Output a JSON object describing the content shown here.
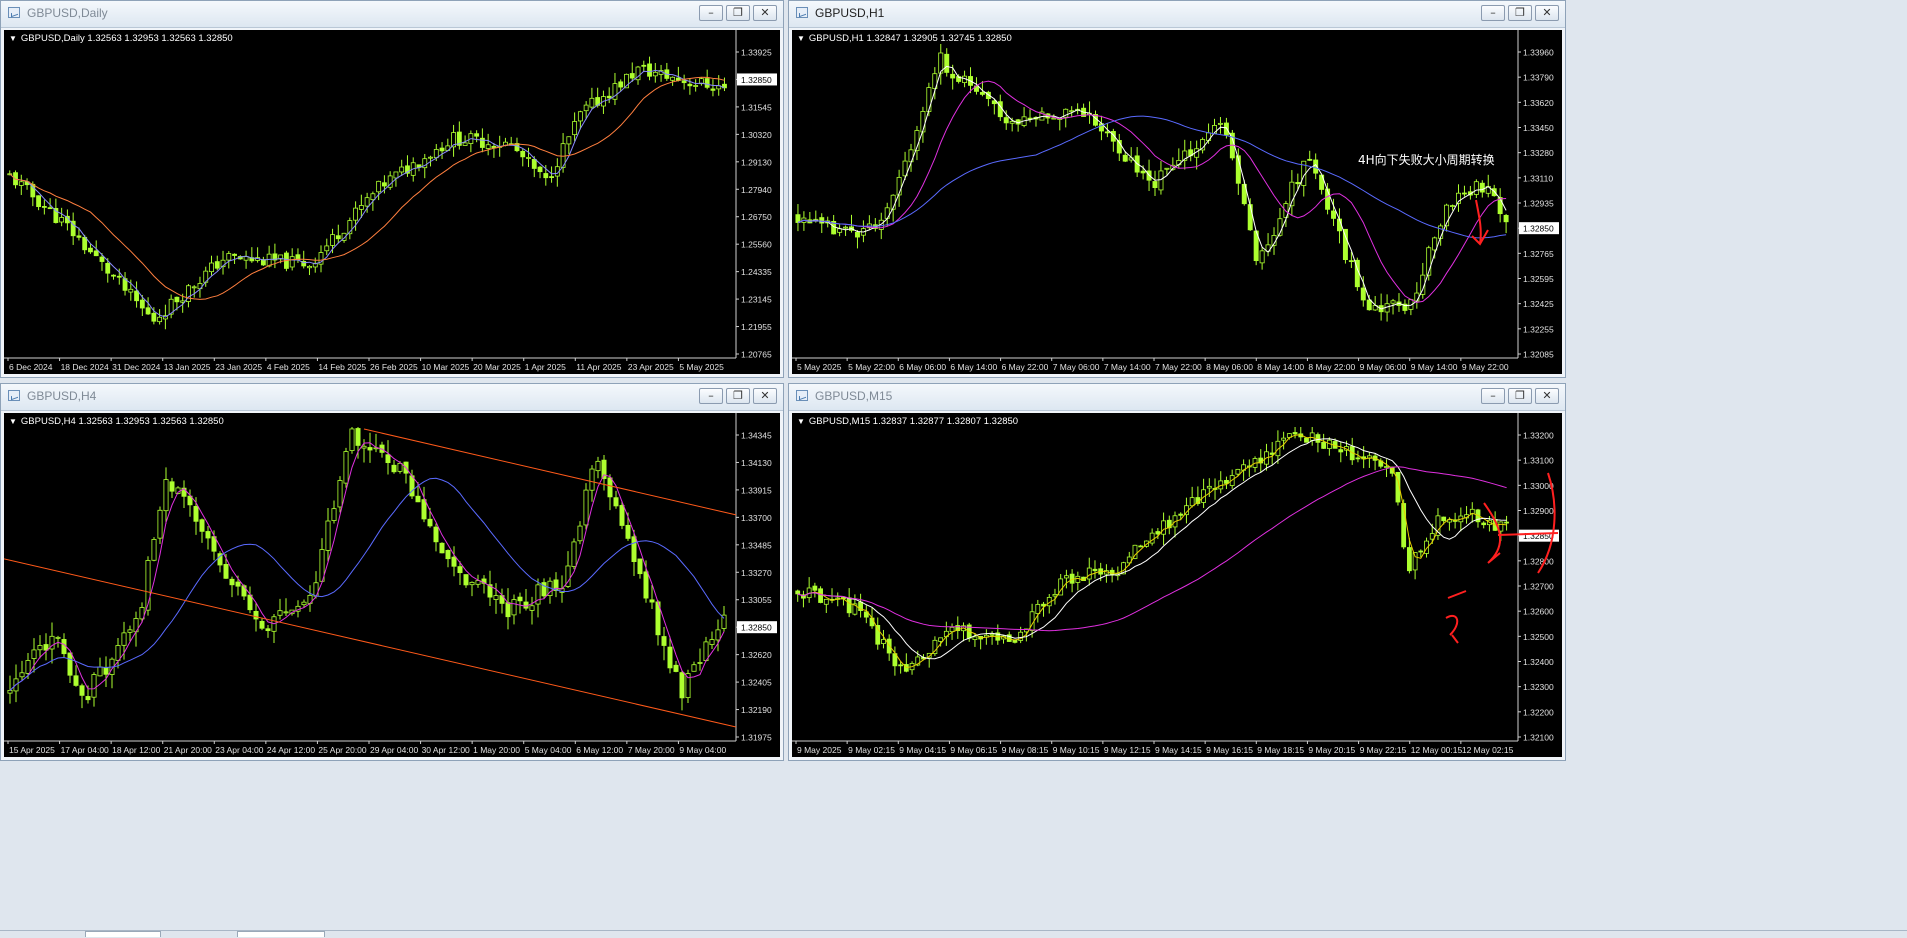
{
  "windows": [
    {
      "id": "daily",
      "title": "GBPUSD,Daily",
      "title_dim": true,
      "header": "GBPUSD,Daily  1.32563 1.32953 1.32563 1.32850",
      "price_levels": [
        "1.33925",
        "1.32850",
        "1.31545",
        "1.30320",
        "1.29130",
        "1.27940",
        "1.26750",
        "1.25560",
        "1.24335",
        "1.23145",
        "1.21955",
        "1.20765"
      ],
      "price_min": 1.2045,
      "price_max": 1.345,
      "current_price": "1.32850",
      "time_labels": [
        "6 Dec 2024",
        "18 Dec 2024",
        "31 Dec 2024",
        "13 Jan 2025",
        "23 Jan 2025",
        "4 Feb 2025",
        "14 Feb 2025",
        "26 Feb 2025",
        "10 Mar 2025",
        "20 Mar 2025",
        "1 Apr 2025",
        "11 Apr 2025",
        "23 Apr 2025",
        "5 May 2025"
      ],
      "annotation": ""
    },
    {
      "id": "h1",
      "title": "GBPUSD,H1",
      "title_dim": false,
      "header": "GBPUSD,H1  1.32847 1.32905 1.32745 1.32850",
      "price_levels": [
        "1.33960",
        "1.33790",
        "1.33620",
        "1.33450",
        "1.33280",
        "1.33110",
        "1.32935",
        "1.32850",
        "1.32765",
        "1.32595",
        "1.32425",
        "1.32255",
        "1.32085"
      ],
      "price_min": 1.3203,
      "price_max": 1.3409,
      "current_price": "1.32850",
      "time_labels": [
        "5 May 2025",
        "5 May 22:00",
        "6 May 06:00",
        "6 May 14:00",
        "6 May 22:00",
        "7 May 06:00",
        "7 May 14:00",
        "7 May 22:00",
        "8 May 06:00",
        "8 May 14:00",
        "8 May 22:00",
        "9 May 06:00",
        "9 May 14:00",
        "9 May 22:00"
      ],
      "annotation": "4H向下失败大小周期转换"
    },
    {
      "id": "h4",
      "title": "GBPUSD,H4",
      "title_dim": true,
      "header": "GBPUSD,H4  1.32563 1.32953 1.32563 1.32850",
      "price_levels": [
        "1.34345",
        "1.34130",
        "1.33915",
        "1.33700",
        "1.33485",
        "1.33270",
        "1.33055",
        "1.32850",
        "1.32620",
        "1.32405",
        "1.32190",
        "1.31975"
      ],
      "price_min": 1.319,
      "price_max": 1.345,
      "current_price": "1.32850",
      "time_labels": [
        "15 Apr 2025",
        "17 Apr 04:00",
        "18 Apr 12:00",
        "21 Apr 20:00",
        "23 Apr 04:00",
        "24 Apr 12:00",
        "25 Apr 20:00",
        "29 Apr 04:00",
        "30 Apr 12:00",
        "1 May 20:00",
        "5 May 04:00",
        "6 May 12:00",
        "7 May 20:00",
        "9 May 04:00"
      ],
      "annotation": ""
    },
    {
      "id": "m15",
      "title": "GBPUSD,M15",
      "title_dim": true,
      "header": "GBPUSD,M15  1.32837 1.32877 1.32807 1.32850",
      "price_levels": [
        "1.33200",
        "1.33100",
        "1.33000",
        "1.32900",
        "1.32850",
        "1.32800",
        "1.32700",
        "1.32600",
        "1.32500",
        "1.32400",
        "1.32300",
        "1.32200",
        "1.32100"
      ],
      "price_min": 1.3206,
      "price_max": 1.3324,
      "current_price": "1.32850",
      "time_labels": [
        "9 May 2025",
        "9 May 02:15",
        "9 May 04:15",
        "9 May 06:15",
        "9 May 08:15",
        "9 May 10:15",
        "9 May 12:15",
        "9 May 14:15",
        "9 May 16:15",
        "9 May 18:15",
        "9 May 20:15",
        "9 May 22:15",
        "12 May 00:15",
        "12 May 02:15"
      ],
      "annotation": ""
    }
  ],
  "window_buttons": {
    "minimize": "–",
    "restore": "❐",
    "close": "✕"
  },
  "colors": {
    "chart_bg": "#000000",
    "candle": "#adff2f",
    "ma_fast_daily": "#8a8aff",
    "ma_slow_daily": "#ff7f3f",
    "ma_white": "#ffffff",
    "ma_magenta": "#e030e0",
    "ma_blue": "#5a6aff",
    "ma_yellow": "#e8d000",
    "channel": "#ff5a1a",
    "annotation_red": "#ff2020"
  },
  "icons": [
    "chart-window-icon",
    "minimize-icon",
    "restore-icon",
    "close-icon",
    "dropdown-triangle-icon"
  ]
}
